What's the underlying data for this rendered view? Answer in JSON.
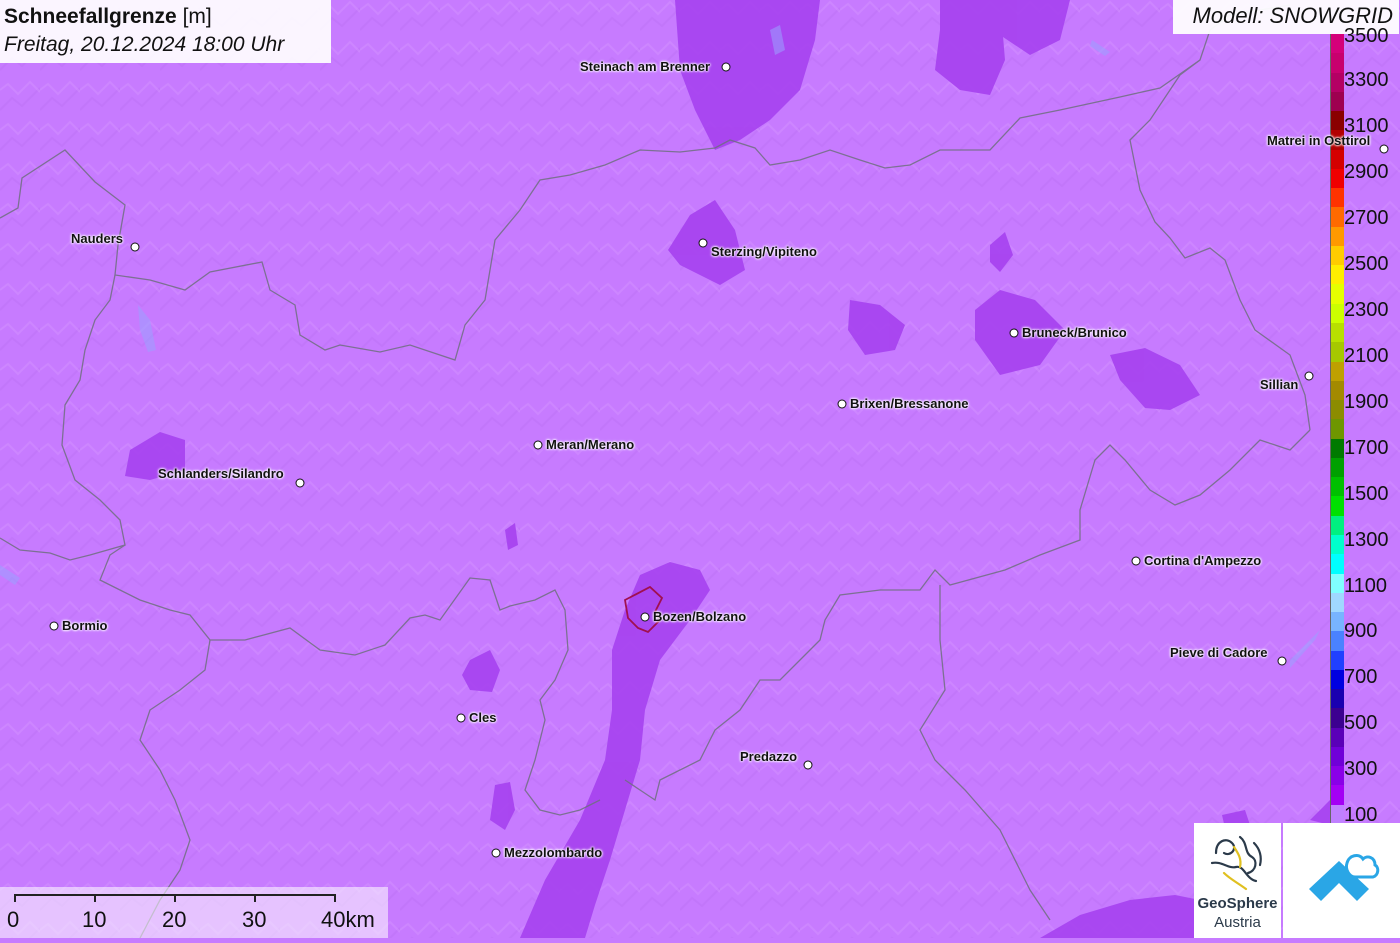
{
  "title": {
    "parameter": "Schneefallgrenze",
    "unit": "[m]",
    "datetime": "Freitag, 20.12.2024 18:00 Uhr"
  },
  "model": "Modell: SNOWGRID",
  "legend": {
    "labels": [
      "3500",
      "3300",
      "3100",
      "2900",
      "2700",
      "2500",
      "2300",
      "2100",
      "1900",
      "1700",
      "1500",
      "1300",
      "1100",
      "900",
      "700",
      "500",
      "300",
      "100"
    ],
    "colors": [
      "#d4007a",
      "#c8006e",
      "#b40064",
      "#9e0050",
      "#8a0000",
      "#b30000",
      "#d40000",
      "#f00000",
      "#ff3300",
      "#ff6a00",
      "#ff9900",
      "#ffcc00",
      "#ffee00",
      "#e6ff00",
      "#ccff00",
      "#b8e000",
      "#a6c800",
      "#bfa000",
      "#a38a00",
      "#8c8c00",
      "#6e9600",
      "#007a00",
      "#00a000",
      "#00c000",
      "#00e000",
      "#00f080",
      "#00ffcc",
      "#00ffff",
      "#80ffff",
      "#a0d8ff",
      "#78b4ff",
      "#4a82ff",
      "#2040ff",
      "#0000e0",
      "#1a00b0",
      "#3c0090",
      "#5a00b8",
      "#7000d8",
      "#8a00e8",
      "#a400f4",
      "#c080ff"
    ]
  },
  "cities": [
    {
      "name": "Steinach am Brenner"
    },
    {
      "name": "Matrei in Osttirol"
    },
    {
      "name": "Nauders"
    },
    {
      "name": "Sterzing/Vipiteno"
    },
    {
      "name": "Bruneck/Brunico"
    },
    {
      "name": "Sillian"
    },
    {
      "name": "Brixen/Bressanone"
    },
    {
      "name": "Meran/Merano"
    },
    {
      "name": "Schlanders/Silandro"
    },
    {
      "name": "Cortina d'Ampezzo"
    },
    {
      "name": "Bormio"
    },
    {
      "name": "Bozen/Bolzano"
    },
    {
      "name": "Pieve di Cadore"
    },
    {
      "name": "Cles"
    },
    {
      "name": "Predazzo"
    },
    {
      "name": "Mezzolombardo"
    }
  ],
  "scale": {
    "labels": [
      "0",
      "10",
      "20",
      "30",
      "40km"
    ]
  },
  "logos": {
    "geosphere_line1": "GeoSphere",
    "geosphere_line2": "Austria"
  }
}
